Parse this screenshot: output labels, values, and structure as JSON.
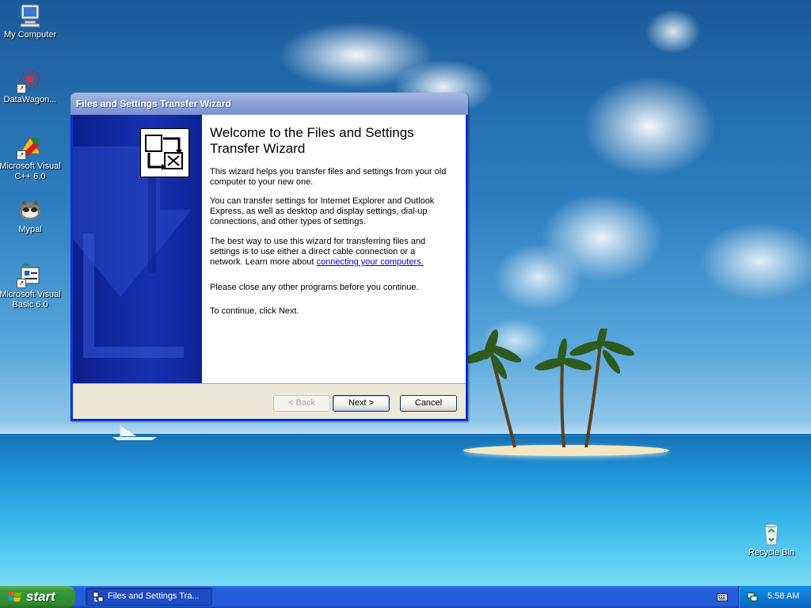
{
  "desktop": {
    "icons": [
      {
        "label": "My Computer",
        "icon": "computer-icon"
      },
      {
        "label": "DataWagon...",
        "icon": "datawagon-icon"
      },
      {
        "label": "Microsoft Visual C++ 6.0",
        "icon": "visual-cpp-icon"
      },
      {
        "label": "Mypal",
        "icon": "mypal-icon"
      },
      {
        "label": "Microsoft Visual Basic 6.0",
        "icon": "visual-basic-icon"
      },
      {
        "label": "Recycle Bin",
        "icon": "recycle-bin-icon"
      }
    ]
  },
  "wizard": {
    "title": "Files and Settings Transfer Wizard",
    "heading": "Welcome to the Files and Settings Transfer Wizard",
    "para1": "This wizard helps you transfer files and settings from your old computer to your new one.",
    "para2": "You can transfer settings for Internet Explorer and Outlook Express, as well as desktop and display settings, dial-up connections, and other types of settings.",
    "para3_text": "The best way to use this wizard for transferring files and settings is to use either a direct cable connection or a network. Learn more about ",
    "para3_link": "connecting your computers.",
    "para4": "Please close any other programs before you continue.",
    "para5": "To continue, click Next.",
    "buttons": {
      "back": "< Back",
      "next": "Next >",
      "cancel": "Cancel"
    }
  },
  "taskbar": {
    "start_label": "start",
    "task_label": "Files and Settings Tra...",
    "clock": "5:58 AM"
  },
  "colors": {
    "taskbar_blue": "#245edb",
    "start_green": "#3c9a3c",
    "window_sidebar": "#1630b0",
    "link": "#0000cc"
  }
}
